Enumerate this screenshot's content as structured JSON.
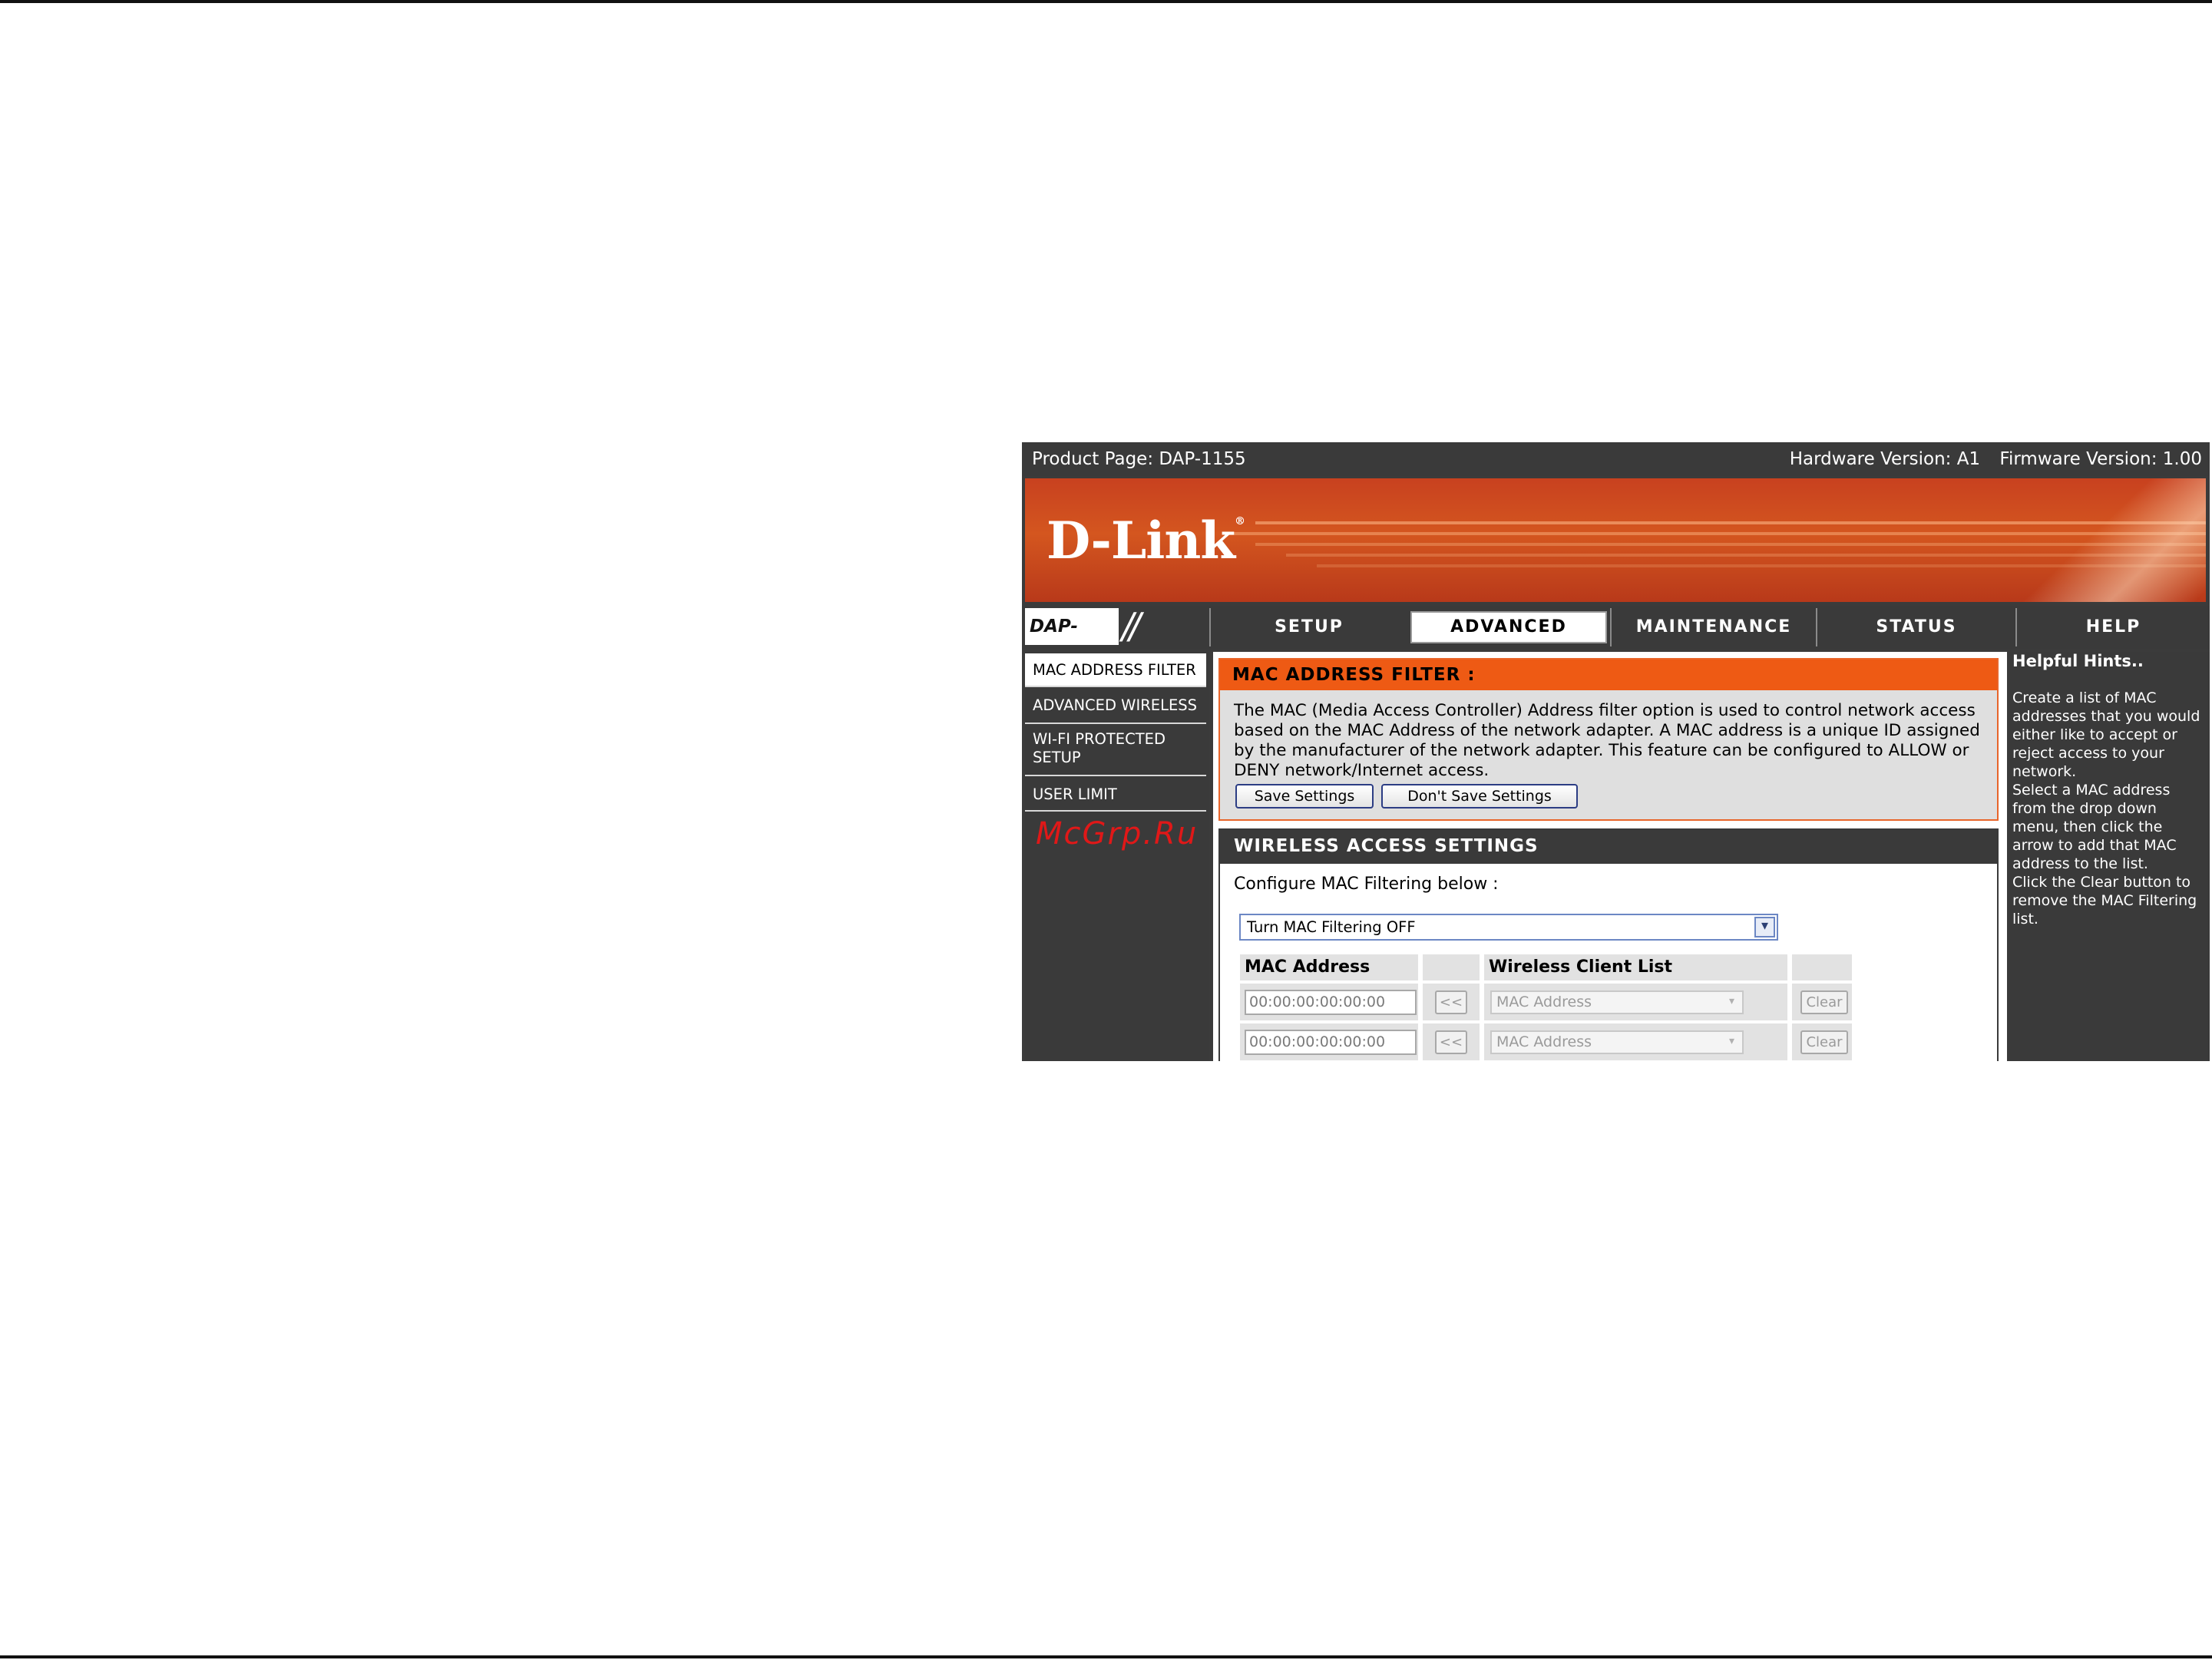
{
  "topbar": {
    "product_page": "Product Page: DAP-1155",
    "hardware_version": "Hardware Version: A1",
    "firmware_version": "Firmware Version: 1.00"
  },
  "brand": {
    "logo_text": "D-Link",
    "model": "DAP-1155"
  },
  "nav": {
    "tabs": [
      {
        "label": "SETUP"
      },
      {
        "label": "ADVANCED",
        "active": true
      },
      {
        "label": "MAINTENANCE"
      },
      {
        "label": "STATUS"
      },
      {
        "label": "HELP"
      }
    ]
  },
  "sidebar": {
    "items": [
      {
        "label": "MAC ADDRESS FILTER",
        "active": true
      },
      {
        "label": "ADVANCED WIRELESS"
      },
      {
        "label": "WI-FI PROTECTED SETUP"
      },
      {
        "label": "USER LIMIT"
      }
    ],
    "watermark": "McGrp.Ru"
  },
  "mac_filter": {
    "title": "MAC ADDRESS FILTER :",
    "description": "The MAC (Media Access Controller) Address filter option is used to control network access based on the MAC Address of the network adapter. A MAC address is a unique ID assigned by the manufacturer of the network adapter. This feature can be configured to ALLOW or DENY network/Internet access.",
    "save_label": "Save Settings",
    "dont_save_label": "Don't Save Settings"
  },
  "wireless_access": {
    "title": "WIRELESS ACCESS SETTINGS",
    "configure_label": "Configure MAC Filtering below :",
    "filter_mode": "Turn MAC Filtering OFF",
    "columns": {
      "mac": "MAC Address",
      "client_list": "Wireless Client List"
    },
    "rows": [
      {
        "mac_value": "00:00:00:00:00:00",
        "add_label": "<<",
        "client_placeholder": "MAC Address",
        "clear_label": "Clear"
      },
      {
        "mac_value": "00:00:00:00:00:00",
        "add_label": "<<",
        "client_placeholder": "MAC Address",
        "clear_label": "Clear"
      }
    ]
  },
  "help": {
    "title": "Helpful Hints..",
    "hints": [
      "Create a list of MAC addresses that you would either like to accept or reject access to your network.",
      "Select a MAC address from the drop down menu, then click the arrow to add that MAC address to the list.",
      "Click the Clear button to remove the MAC Filtering list."
    ]
  },
  "colors": {
    "header_orange": "#ee5a14",
    "dark_gray": "#3a3a3a",
    "button_border": "#2c3d84",
    "watermark_red": "#e01818"
  }
}
